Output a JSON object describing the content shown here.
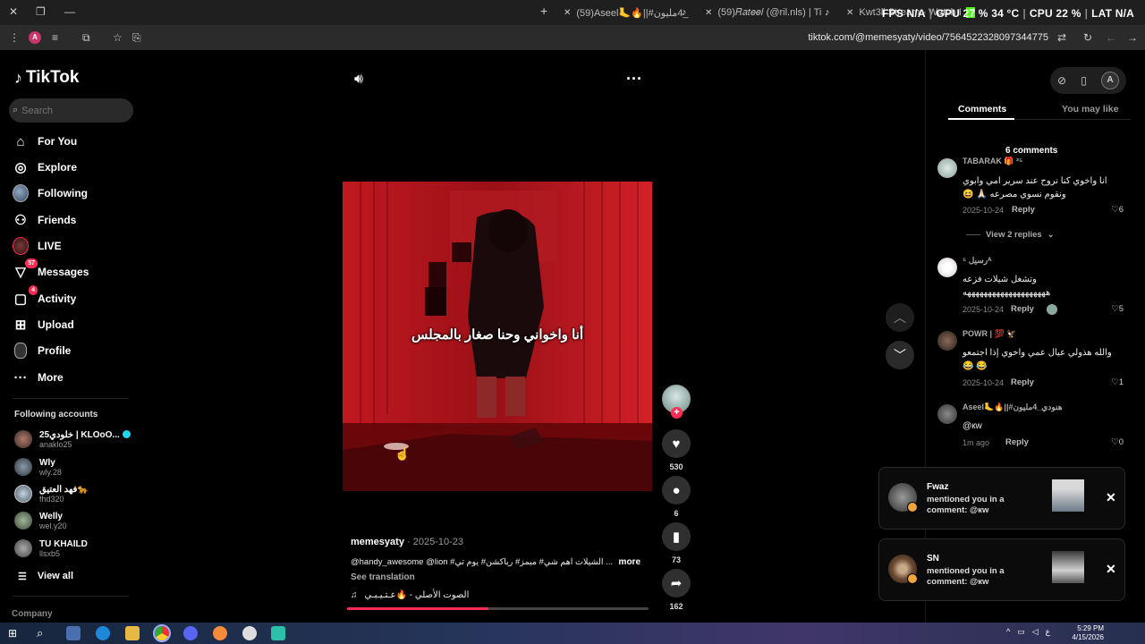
{
  "browser": {
    "tabs": [
      {
        "title": "(59)Aseel🦶🔥||#هنودي_4مليون",
        "favicon": "tiktok"
      },
      {
        "title": "(59)𝑅𝑎𝑡𝑒𝑒𝑙 (@ril.nls) | TikTok",
        "favicon": "tiktok"
      },
      {
        "title": "Kwt3li Stream - Watch Live on",
        "favicon": "kick"
      }
    ],
    "new_tab": "+",
    "url": "tiktok.com/@memesyaty/video/7564522328097344775",
    "hud": {
      "fps_label": "FPS",
      "fps": "N/A",
      "gpu_label": "GPU",
      "gpu_pct": "27 %",
      "gpu_temp": "34 °C",
      "cpu_label": "CPU",
      "cpu_pct": "22 %",
      "lat_label": "LAT",
      "lat": "N/A"
    },
    "profile_initial": "A"
  },
  "sidebar": {
    "logo": "TikTok",
    "search_placeholder": "Search",
    "nav": [
      {
        "label": "For You",
        "icon": "home-icon"
      },
      {
        "label": "Explore",
        "icon": "compass-icon"
      },
      {
        "label": "Following",
        "icon": "following-avatar"
      },
      {
        "label": "Friends",
        "icon": "friends-icon"
      },
      {
        "label": "LIVE",
        "icon": "live-avatar"
      },
      {
        "label": "Messages",
        "icon": "send-icon",
        "badge": "57"
      },
      {
        "label": "Activity",
        "icon": "inbox-icon",
        "badge": "4"
      },
      {
        "label": "Upload",
        "icon": "plus-square-icon"
      },
      {
        "label": "Profile",
        "icon": "profile-avatar"
      },
      {
        "label": "More",
        "icon": "ellipsis-icon"
      }
    ],
    "following_title": "Following accounts",
    "accounts": [
      {
        "name": "25خلودي | KLOoO...",
        "handle": "anaklo25",
        "verified": true
      },
      {
        "name": "Wly",
        "handle": "wly.28"
      },
      {
        "name": "فهد العتيق🐆",
        "handle": "fhd320"
      },
      {
        "name": "Welly",
        "handle": "wel.y20"
      },
      {
        "name": "TU KHAILD",
        "handle": "llsxb5"
      }
    ],
    "view_all": "View all",
    "company": "Company"
  },
  "video": {
    "overlay_text": "أنا واخواني وحنا صغار بالمجلس",
    "author": "memesyaty",
    "date": "· 2025-10-23",
    "description": "@handy_awesome @lion #الشيلات اهم شي# ميمز# رياكشن# يوم تي ...",
    "more": "more",
    "see_translation": "See translation",
    "music": "الصوت الأصلي - 🔥عـتـيـبـي",
    "progress": 0.47
  },
  "actions": {
    "likes": "530",
    "comments": "6",
    "saves": "73",
    "shares": "162"
  },
  "comments_panel": {
    "tab_comments": "Comments",
    "tab_like": "You may like",
    "count": "6 comments",
    "reply_label": "Reply",
    "view_replies": "View 2 replies",
    "items": [
      {
        "name": "TABARAK 🎁 ²⁵",
        "text": "انا واخوي كنا نروح عند سرير امي وابوي\nونقوم نسوي مصرعه 🙏🏻 😆",
        "date": "2025-10-24",
        "likes": "6"
      },
      {
        "name": "رسيل ⁵ᴬ",
        "text": "وتشغل شيلات فزعه\nههههههههههههههههههههه",
        "date": "2025-10-24",
        "likes": "5"
      },
      {
        "name": "POWR | 💯 🦅",
        "text": "والله هذولي عيال عمي واخوي إذا اجتمعو\n😂 😂",
        "date": "2025-10-24",
        "likes": "1"
      },
      {
        "name": "Aseel🦶🔥||#هنودي_4مليون",
        "text": "@кw",
        "date": "1m ago",
        "likes": "0"
      }
    ]
  },
  "notifications": [
    {
      "name": "Fwaz",
      "message": "mentioned you in a comment: @кw"
    },
    {
      "name": "SN",
      "message": "mentioned you in a comment: @кw"
    }
  ],
  "taskbar": {
    "time": "5:29 PM",
    "date": "4/15/2026",
    "lang": "ع"
  }
}
